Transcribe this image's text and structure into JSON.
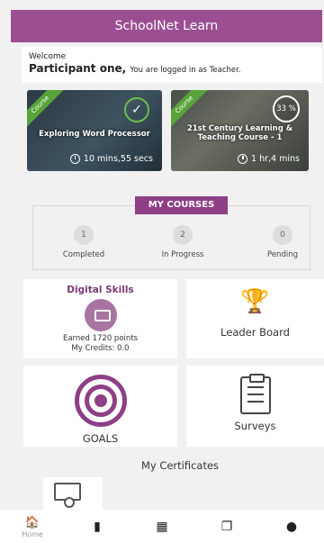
{
  "app": {
    "title": "SchoolNet Learn"
  },
  "welcome": {
    "greeting": "Welcome",
    "name": "Participant one,",
    "role_text": "You are logged in as Teacher."
  },
  "courses": [
    {
      "tag": "Course",
      "title": "Exploring Word Processor",
      "duration": "10 mins,55 secs",
      "status": "completed"
    },
    {
      "tag": "Course",
      "title": "21st Century Learning & Teaching Course - 1",
      "duration": "1 hr,4 mins",
      "progress": "33 %"
    }
  ],
  "my_courses": {
    "label": "MY COURSES",
    "stats": [
      {
        "value": "1",
        "label": "Completed"
      },
      {
        "value": "2",
        "label": "In Progress"
      },
      {
        "value": "0",
        "label": "Pending"
      }
    ]
  },
  "tiles": {
    "digital_skills": {
      "title": "Digital Skills",
      "points": "Earned 1720 points",
      "credits": "My Credits: 0.0",
      "icon": "badge-icon"
    },
    "leader_board": {
      "title": "Leader Board",
      "icon": "trophy-icon"
    },
    "goals": {
      "title": "GOALS",
      "icon": "target-icon"
    },
    "surveys": {
      "title": "Surveys",
      "icon": "clipboard-icon"
    }
  },
  "certificates": {
    "title": "My Certificates",
    "icon": "certificate-icon"
  },
  "bottom_nav": [
    {
      "label": "Home",
      "icon": "home-icon",
      "active": true
    },
    {
      "label": "",
      "icon": "document-icon"
    },
    {
      "label": "",
      "icon": "calendar-icon"
    },
    {
      "label": "",
      "icon": "copy-icon"
    },
    {
      "label": "",
      "icon": "user-icon"
    }
  ],
  "colors": {
    "primary": "#9b4f92",
    "accent_dark": "#8e3f86",
    "ribbon": "#59a33a"
  }
}
